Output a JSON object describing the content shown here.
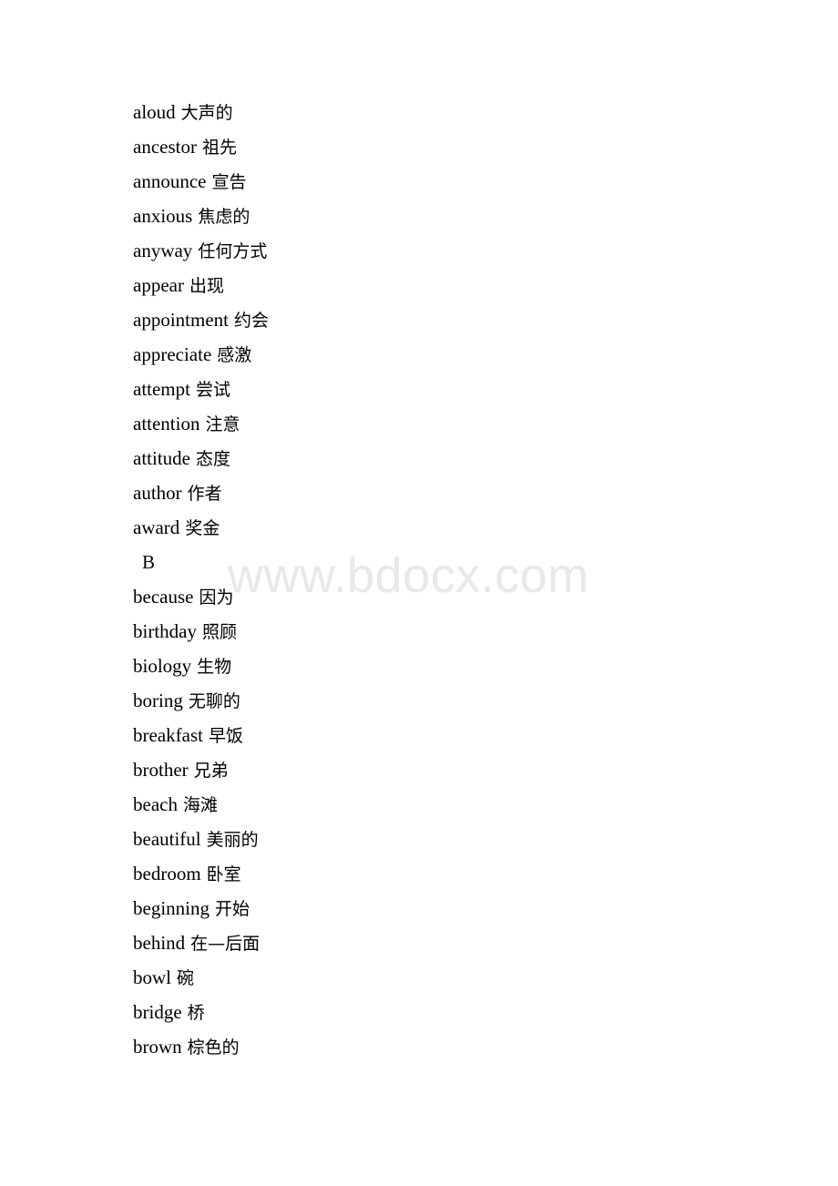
{
  "document": {
    "watermark": "www.bdocx.com",
    "blocks": [
      {
        "kind": "entry",
        "term": "aloud",
        "gloss": "大声的"
      },
      {
        "kind": "entry",
        "term": "ancestor",
        "gloss": "祖先"
      },
      {
        "kind": "entry",
        "term": "announce",
        "gloss": "宣告"
      },
      {
        "kind": "entry",
        "term": "anxious",
        "gloss": "焦虑的"
      },
      {
        "kind": "entry",
        "term": "anyway",
        "gloss": "任何方式"
      },
      {
        "kind": "entry",
        "term": "appear",
        "gloss": "出现"
      },
      {
        "kind": "entry",
        "term": "appointment",
        "gloss": "约会"
      },
      {
        "kind": "entry",
        "term": "appreciate",
        "gloss": "感激"
      },
      {
        "kind": "entry",
        "term": "attempt",
        "gloss": "尝试"
      },
      {
        "kind": "entry",
        "term": "attention",
        "gloss": "注意"
      },
      {
        "kind": "entry",
        "term": "attitude",
        "gloss": "态度"
      },
      {
        "kind": "entry",
        "term": "author",
        "gloss": "作者"
      },
      {
        "kind": "entry",
        "term": "award",
        "gloss": "奖金"
      },
      {
        "kind": "heading",
        "term": "B",
        "gloss": ""
      },
      {
        "kind": "entry",
        "term": "because",
        "gloss": "因为"
      },
      {
        "kind": "entry",
        "term": "birthday",
        "gloss": "照顾"
      },
      {
        "kind": "entry",
        "term": "biology",
        "gloss": "生物"
      },
      {
        "kind": "entry",
        "term": "boring",
        "gloss": "无聊的"
      },
      {
        "kind": "entry",
        "term": "breakfast",
        "gloss": "早饭"
      },
      {
        "kind": "entry",
        "term": "brother",
        "gloss": "兄弟"
      },
      {
        "kind": "entry",
        "term": "beach",
        "gloss": "海滩"
      },
      {
        "kind": "entry",
        "term": "beautiful",
        "gloss": "美丽的"
      },
      {
        "kind": "entry",
        "term": "bedroom",
        "gloss": "卧室"
      },
      {
        "kind": "entry",
        "term": "beginning",
        "gloss": "开始"
      },
      {
        "kind": "entry",
        "term": "behind",
        "gloss": "在—后面"
      },
      {
        "kind": "entry",
        "term": "bowl",
        "gloss": "碗"
      },
      {
        "kind": "entry",
        "term": "bridge",
        "gloss": "桥"
      },
      {
        "kind": "entry",
        "term": "brown",
        "gloss": "棕色的"
      }
    ]
  }
}
